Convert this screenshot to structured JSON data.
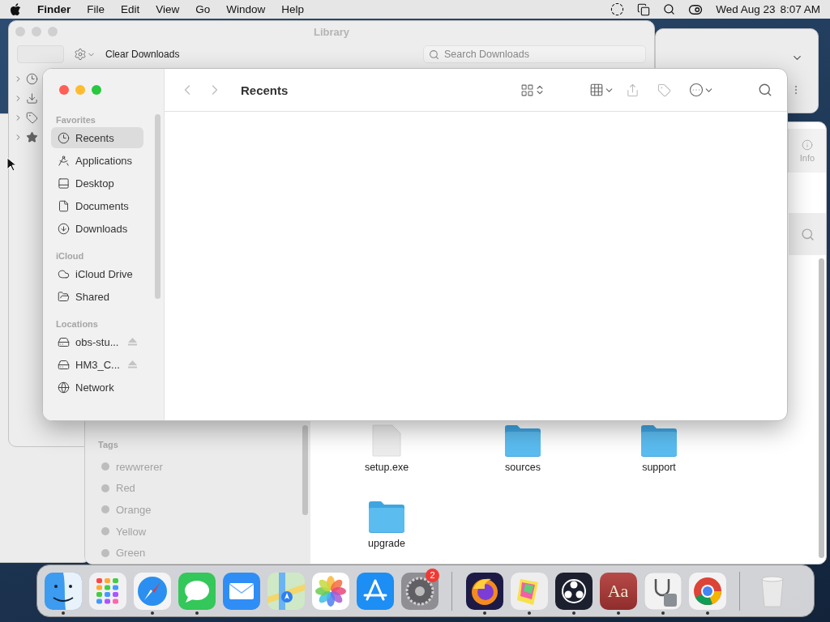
{
  "menu_bar": {
    "app": "Finder",
    "menus": [
      "File",
      "Edit",
      "View",
      "Go",
      "Window",
      "Help"
    ],
    "date": "Wed Aug 23",
    "time": "8:07 AM"
  },
  "library_window": {
    "title": "Library",
    "toolbar_button": "Clear Downloads",
    "search": {
      "placeholder": "Search Downloads"
    },
    "tree": [
      {
        "kind": "clock"
      },
      {
        "kind": "download"
      },
      {
        "kind": "tag"
      },
      {
        "kind": "star"
      }
    ]
  },
  "back_finder_window": {
    "info_button": "Info",
    "tags_heading": "Tags",
    "tags": [
      {
        "label": "rewwrerer"
      },
      {
        "label": "Red"
      },
      {
        "label": "Orange"
      },
      {
        "label": "Yellow"
      },
      {
        "label": "Green"
      }
    ],
    "files": [
      {
        "name": "setup.exe",
        "kind": "document"
      },
      {
        "name": "sources",
        "kind": "folder"
      },
      {
        "name": "support",
        "kind": "folder"
      },
      {
        "name": "upgrade",
        "kind": "folder",
        "selected": false
      }
    ]
  },
  "finder_window": {
    "title": "Recents",
    "back_disabled": true,
    "forward_disabled": true,
    "sidebar": [
      {
        "heading": "Favorites",
        "items": [
          {
            "label": "Recents",
            "kind": "clock",
            "selected": true
          },
          {
            "label": "Applications",
            "kind": "apps",
            "selected": false
          },
          {
            "label": "Desktop",
            "kind": "desktop",
            "selected": false
          },
          {
            "label": "Documents",
            "kind": "document",
            "selected": false
          },
          {
            "label": "Downloads",
            "kind": "download",
            "selected": false
          }
        ]
      },
      {
        "heading": "iCloud",
        "items": [
          {
            "label": "iCloud Drive",
            "kind": "cloud",
            "selected": false
          },
          {
            "label": "Shared",
            "kind": "shared",
            "selected": false
          }
        ]
      },
      {
        "heading": "Locations",
        "items": [
          {
            "label": "obs-stu...",
            "kind": "drive",
            "eject": true,
            "selected": false
          },
          {
            "label": "HM3_C...",
            "kind": "drive",
            "eject": true,
            "selected": false
          },
          {
            "label": "Network",
            "kind": "network",
            "selected": false
          }
        ]
      }
    ]
  },
  "dock": {
    "apps": [
      {
        "kind": "finder",
        "running": true
      },
      {
        "kind": "launchpad",
        "running": false
      },
      {
        "kind": "safari",
        "running": true
      },
      {
        "kind": "messages",
        "running": true
      },
      {
        "kind": "mail",
        "running": false
      },
      {
        "kind": "maps",
        "running": false
      },
      {
        "kind": "photos",
        "running": false
      },
      {
        "kind": "appstore",
        "running": false
      },
      {
        "kind": "settings",
        "running": false,
        "badge": "2"
      },
      {
        "kind": "separator"
      },
      {
        "kind": "firefox",
        "running": true
      },
      {
        "kind": "stickies",
        "running": true
      },
      {
        "kind": "obs",
        "running": true
      },
      {
        "kind": "dictionary",
        "running": true,
        "label": "Aa"
      },
      {
        "kind": "utility",
        "running": true
      },
      {
        "kind": "chrome",
        "running": true
      },
      {
        "kind": "separator"
      },
      {
        "kind": "trash",
        "running": false
      }
    ]
  }
}
